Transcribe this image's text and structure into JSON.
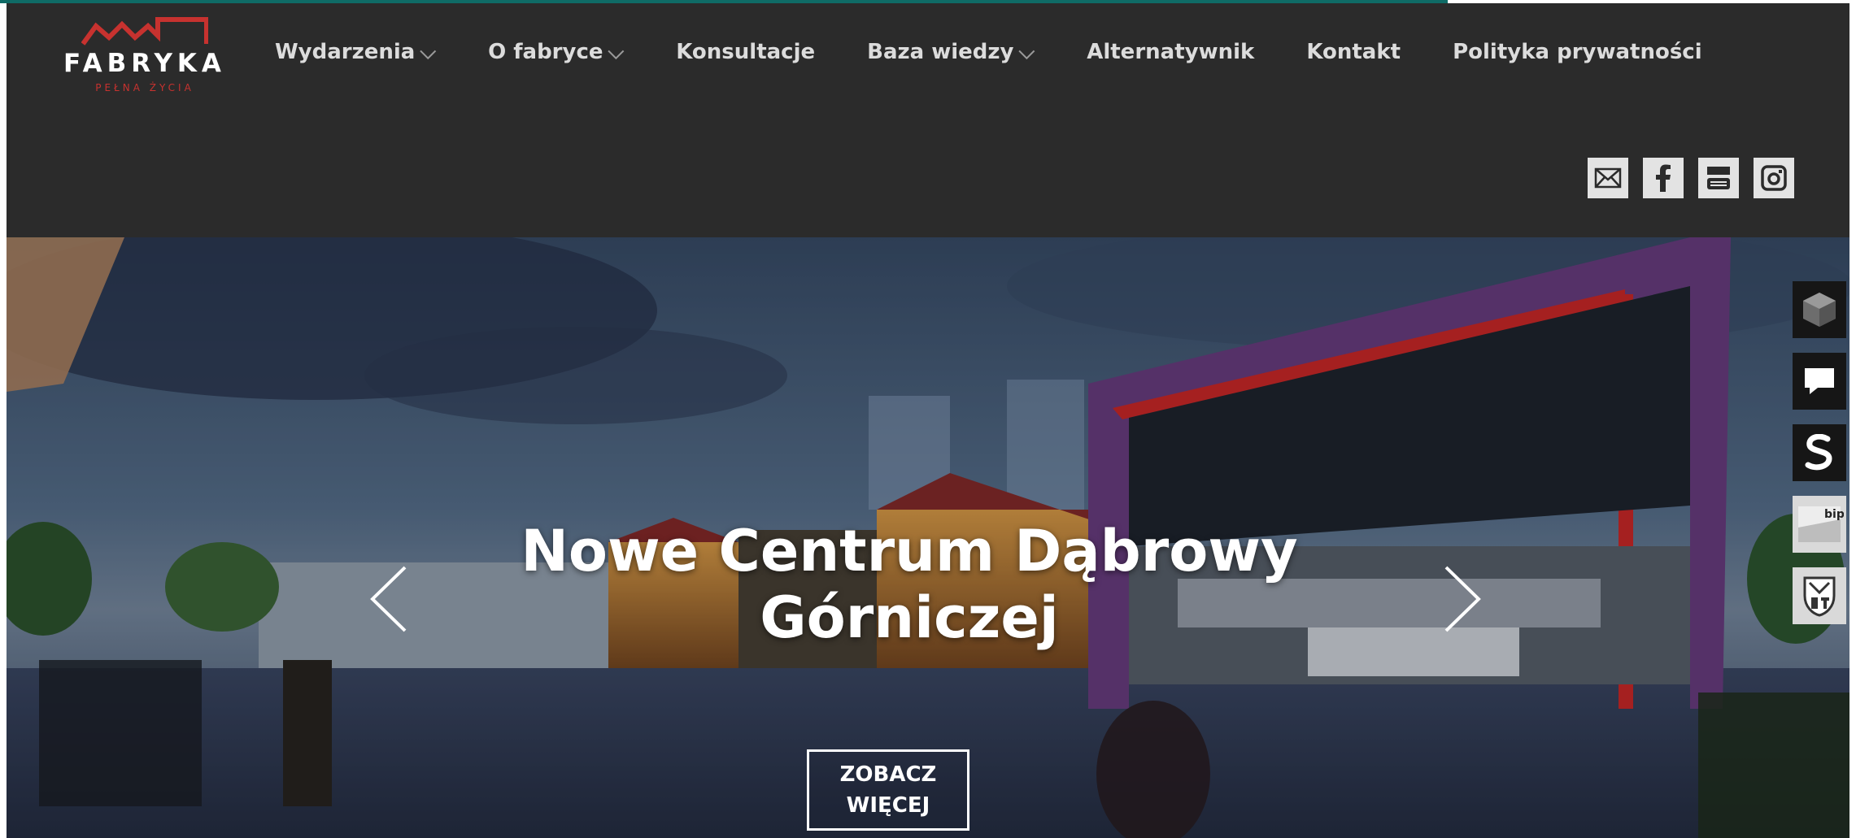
{
  "logo": {
    "wordmark": "FABRYKA",
    "tagline": "PEŁNA ŻYCIA",
    "accent_color": "#c7322f"
  },
  "nav": {
    "items": [
      {
        "label": "Wydarzenia",
        "has_dropdown": true
      },
      {
        "label": "O fabryce",
        "has_dropdown": true
      },
      {
        "label": "Konsultacje",
        "has_dropdown": false
      },
      {
        "label": "Baza wiedzy",
        "has_dropdown": true
      },
      {
        "label": "Alternatywnik",
        "has_dropdown": false
      },
      {
        "label": "Kontakt",
        "has_dropdown": false
      },
      {
        "label": "Polityka prywatności",
        "has_dropdown": false
      }
    ],
    "dropdown_glyph": "⌵"
  },
  "social": {
    "icons": [
      "mail-icon",
      "facebook-icon",
      "youtube-icon",
      "instagram-icon"
    ]
  },
  "hero": {
    "title_line1": "Nowe Centrum Dąbrowy",
    "title_line2": "Górniczej",
    "cta_line1": "ZOBACZ",
    "cta_line2": "WIĘCEJ"
  },
  "side_rail": {
    "icons": [
      "cube-icon",
      "chat-icon",
      "fabryka-s-icon",
      "bip-icon",
      "coat-of-arms-icon"
    ],
    "bip_label": "bip"
  },
  "colors": {
    "header_bg": "#2b2b2b",
    "top_accent": "#0f6b66",
    "frame_purple": "#6e3f86",
    "frame_red": "#d42a2a"
  }
}
